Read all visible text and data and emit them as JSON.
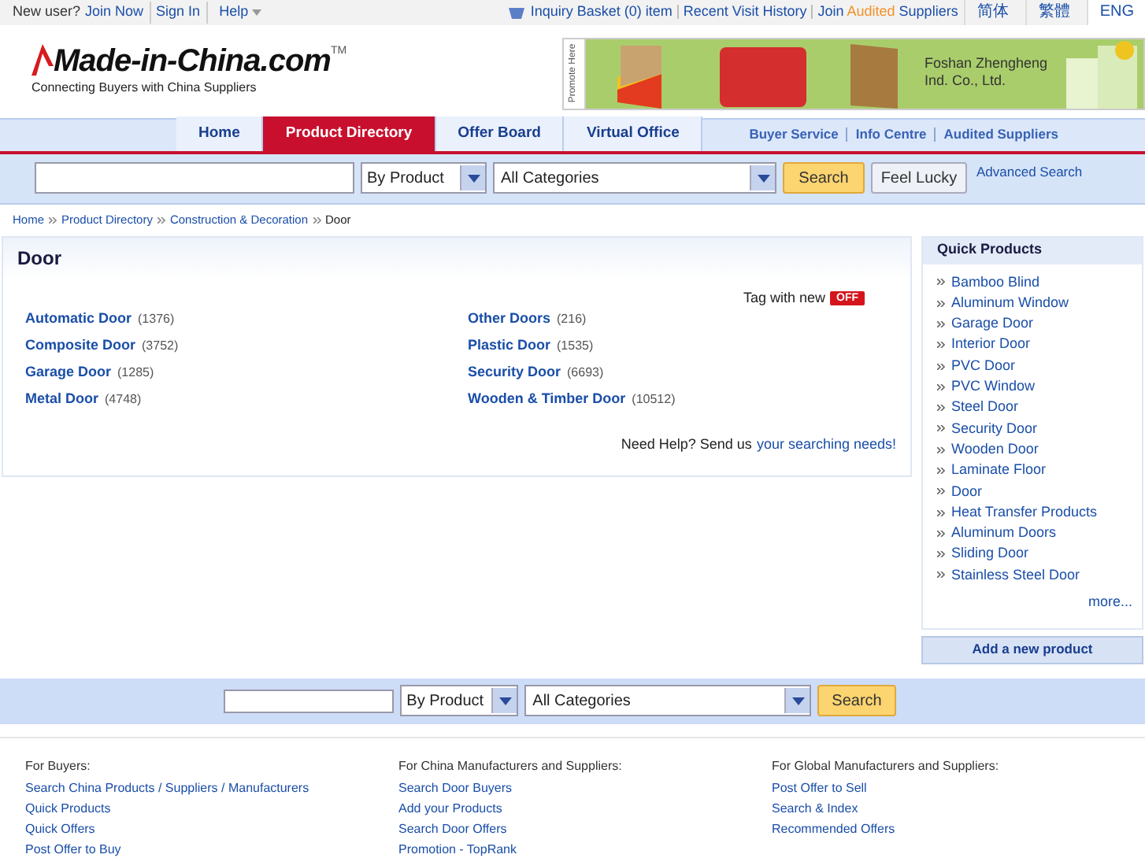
{
  "top_bar": {
    "greeting": "New user?",
    "links": [
      "Join Now",
      "Sign In"
    ],
    "help": "Help",
    "basket": "Inquiry Basket (0) item",
    "history": "Recent Visit History",
    "join_prefix": "Join",
    "join_highlight": "Audited",
    "join_suffix": "Suppliers",
    "languages": [
      {
        "label": "简体",
        "selected": false
      },
      {
        "label": "繁體",
        "selected": false
      },
      {
        "label": "ENG",
        "selected": true
      }
    ]
  },
  "logo": {
    "name": "Made-in-China.com",
    "tm": "TM",
    "tagline": "Connecting Buyers with China Suppliers"
  },
  "banner": {
    "side_label": "Promote Here",
    "company": "Foshan Zhengheng Ind. Co., Ltd."
  },
  "nav": {
    "tabs": [
      {
        "label": "Home",
        "selected": false
      },
      {
        "label": "Product Directory",
        "selected": true
      },
      {
        "label": "Offer Board",
        "selected": false
      },
      {
        "label": "Virtual Office",
        "selected": false
      }
    ],
    "links": [
      "Buyer Service",
      "Info Centre",
      "Audited Suppliers"
    ]
  },
  "search": {
    "type": "By Product",
    "category": "All Categories",
    "search_button": "Search",
    "lucky_button": "Feel Lucky",
    "advanced": "Advanced Search"
  },
  "breadcrumb": [
    "Home",
    "Product Directory",
    "Construction & Decoration",
    "Door"
  ],
  "main": {
    "title": "Door",
    "tag_label": "Tag with new",
    "tag_on": false,
    "tag_state": "OFF",
    "categories": [
      {
        "name": "Automatic Door",
        "count": "(1376)"
      },
      {
        "name": "Composite Door",
        "count": "(3752)"
      },
      {
        "name": "Garage Door",
        "count": "(1285)"
      },
      {
        "name": "Metal Door",
        "count": "(4748)"
      },
      {
        "name": "Other Doors",
        "count": "(216)"
      },
      {
        "name": "Plastic Door",
        "count": "(1535)"
      },
      {
        "name": "Security Door",
        "count": "(6693)"
      },
      {
        "name": "Wooden & Timber Door",
        "count": "(10512)"
      }
    ],
    "help_text": "Need Help? Send us",
    "help_link": "your searching needs!"
  },
  "quick_products": {
    "title": "Quick Products",
    "items": [
      "Bamboo Blind",
      "Aluminum Window",
      "Garage Door",
      "Interior Door",
      "PVC Door",
      "PVC Window",
      "Steel Door",
      "Security Door",
      "Wooden Door",
      "Laminate Floor",
      "Door",
      "Heat Transfer Products",
      "Aluminum Doors",
      "Sliding Door",
      "Stainless Steel Door"
    ],
    "more": "more...",
    "add_button": "Add a new product"
  },
  "footer_search": {
    "type": "By Product",
    "category": "All Categories",
    "search_button": "Search"
  },
  "footer": {
    "columns": [
      {
        "title": "For Buyers:",
        "links": [
          "Search China Products / Suppliers / Manufacturers",
          "Quick Products",
          "Quick Offers",
          "Post Offer to Buy"
        ]
      },
      {
        "title": "For China Manufacturers and Suppliers:",
        "links": [
          "Search Door Buyers",
          "Add your Products",
          "Search Door Offers",
          "Promotion - TopRank"
        ]
      },
      {
        "title": "For Global Manufacturers and Suppliers:",
        "links": [
          "Post Offer to Sell",
          "Search & Index",
          "Recommended Offers"
        ]
      }
    ]
  }
}
